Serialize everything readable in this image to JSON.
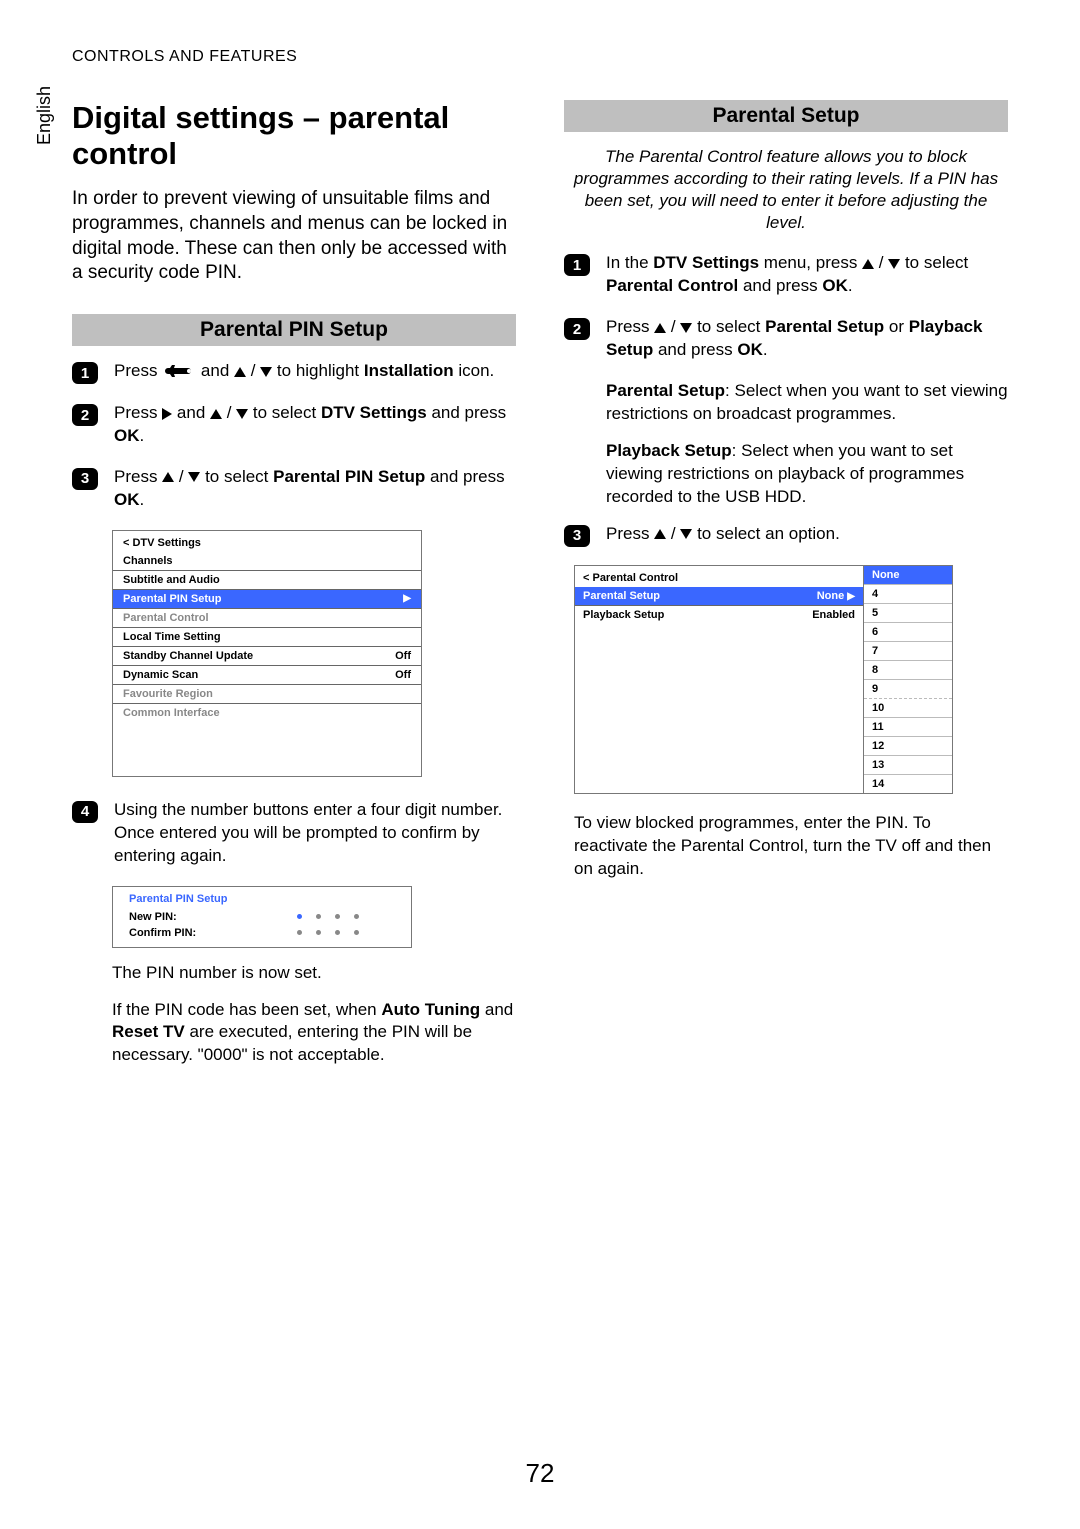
{
  "header": "CONTROLS AND FEATURES",
  "language_tab": "English",
  "page_number": "72",
  "left": {
    "title": "Digital settings – parental control",
    "intro": "In order to prevent viewing of unsuitable films and programmes, channels and menus can be locked in digital mode. These can then only be accessed with a security code PIN.",
    "section_heading": "Parental PIN Setup",
    "steps": {
      "s1_a": "Press ",
      "s1_b": " and ",
      "s1_c": " to highlight ",
      "s1_bold": "Installation",
      "s1_d": " icon.",
      "s2_a": "Press ",
      "s2_b": " and ",
      "s2_c": " to select ",
      "s2_bold": "DTV Settings",
      "s2_d": " and press ",
      "s2_bold2": "OK",
      "s2_e": ".",
      "s3_a": "Press ",
      "s3_b": " to select ",
      "s3_bold": "Parental PIN Setup",
      "s3_c": " and press ",
      "s3_bold2": "OK",
      "s3_d": ".",
      "s4": "Using the number buttons enter a four digit number. Once entered you will be prompted to confirm by entering again."
    },
    "menu": {
      "title": "< DTV Settings",
      "rows": [
        {
          "label": "Channels",
          "value": ""
        },
        {
          "label": "Subtitle and Audio",
          "value": ""
        },
        {
          "label": "Parental PIN Setup",
          "value": "",
          "selected": true,
          "arrow": true
        },
        {
          "label": "Parental Control",
          "value": "",
          "dim": true
        },
        {
          "label": "Local Time Setting",
          "value": ""
        },
        {
          "label": "Standby Channel Update",
          "value": "Off"
        },
        {
          "label": "Dynamic Scan",
          "value": "Off"
        },
        {
          "label": "Favourite Region",
          "value": "",
          "dim": true
        },
        {
          "label": "Common Interface",
          "value": "",
          "dim": true
        }
      ]
    },
    "pin_box": {
      "title": "Parental PIN Setup",
      "new_pin": "New PIN:",
      "confirm_pin": "Confirm PIN:"
    },
    "note1": "The PIN number is now set.",
    "note2_a": "If the PIN code has been set, when ",
    "note2_b1": "Auto Tuning",
    "note2_c": " and ",
    "note2_b2": "Reset TV",
    "note2_d": " are executed, entering the PIN will be necessary. \"0000\" is not acceptable."
  },
  "right": {
    "section_heading": "Parental Setup",
    "intro": "The Parental Control feature allows you to block programmes according to their rating levels. If a PIN has been set, you will need to enter it before adjusting the level.",
    "steps": {
      "s1_a": "In the ",
      "s1_b1": "DTV Settings",
      "s1_b": " menu, press ",
      "s1_c": " to select ",
      "s1_b2": "Parental Control",
      "s1_d": " and press ",
      "s1_b3": "OK",
      "s1_e": ".",
      "s2_a": "Press ",
      "s2_b": " to select ",
      "s2_b1": "Parental Setup",
      "s2_c": " or ",
      "s2_b2": "Playback Setup",
      "s2_d": " and press ",
      "s2_b3": "OK",
      "s2_e": ".",
      "s3_a": "Press ",
      "s3_b": " to select an option."
    },
    "sub1_b": "Parental Setup",
    "sub1": ": Select when you want to set viewing restrictions on broadcast programmes.",
    "sub2_b": "Playback Setup",
    "sub2": ": Select when you want to set viewing restrictions on playback of programmes recorded to the USB HDD.",
    "pc": {
      "title": "< Parental Control",
      "rows": [
        {
          "label": "Parental Setup",
          "value": "None",
          "selected": true,
          "arrow": true
        },
        {
          "label": "Playback Setup",
          "value": "Enabled"
        }
      ],
      "side": [
        "None",
        "4",
        "5",
        "6",
        "7",
        "8",
        "9",
        "10",
        "11",
        "12",
        "13",
        "14"
      ]
    },
    "note": "To view blocked programmes, enter the PIN. To reactivate the Parental Control, turn the TV off and then on again."
  }
}
